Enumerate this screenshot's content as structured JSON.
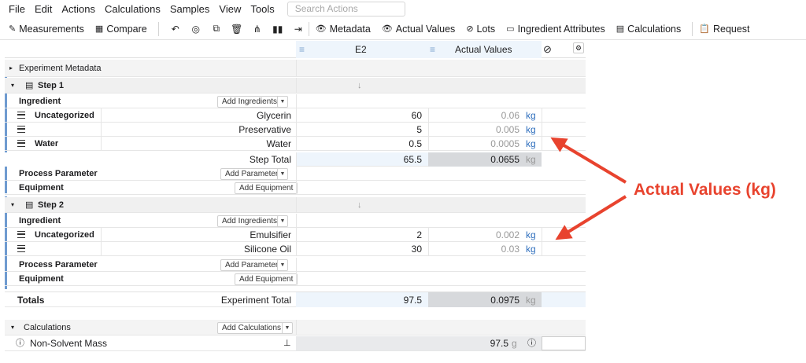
{
  "menu": [
    "File",
    "Edit",
    "Actions",
    "Calculations",
    "Samples",
    "View",
    "Tools"
  ],
  "search": {
    "placeholder": "Search Actions"
  },
  "toolbar": {
    "measurements": "Measurements",
    "compare": "Compare",
    "metadata": "Metadata",
    "actual_values": "Actual Values",
    "lots": "Lots",
    "ingredient_attributes": "Ingredient Attributes",
    "calculations": "Calculations",
    "request": "Request"
  },
  "columns": {
    "e2": "E2",
    "actual": "Actual Values"
  },
  "experiment_metadata": "Experiment Metadata",
  "step1": {
    "title": "Step 1",
    "ingredient": "Ingredient",
    "add_ingredients": "Add Ingredients",
    "rows": [
      {
        "group": "Uncategorized",
        "name": "Glycerin",
        "e2": "60",
        "actual": "0.06",
        "unit": "kg"
      },
      {
        "group": "",
        "name": "Preservative",
        "e2": "5",
        "actual": "0.005",
        "unit": "kg"
      },
      {
        "group": "Water",
        "name": "Water",
        "e2": "0.5",
        "actual": "0.0005",
        "unit": "kg"
      }
    ],
    "total_label": "Step Total",
    "total_e2": "65.5",
    "total_actual": "0.0655",
    "total_unit": "kg",
    "process_parameter": "Process Parameter",
    "add_parameter": "Add Parameter",
    "equipment": "Equipment",
    "add_equipment": "Add Equipment"
  },
  "step2": {
    "title": "Step 2",
    "ingredient": "Ingredient",
    "add_ingredients": "Add Ingredients",
    "rows": [
      {
        "group": "Uncategorized",
        "name": "Emulsifier",
        "e2": "2",
        "actual": "0.002",
        "unit": "kg"
      },
      {
        "group": "",
        "name": "Silicone Oil",
        "e2": "30",
        "actual": "0.03",
        "unit": "kg"
      }
    ],
    "process_parameter": "Process Parameter",
    "add_parameter": "Add Parameter",
    "equipment": "Equipment",
    "add_equipment": "Add Equipment"
  },
  "totals": {
    "label": "Totals",
    "exp_label": "Experiment Total",
    "e2": "97.5",
    "actual": "0.0975",
    "unit": "kg"
  },
  "calculations": {
    "label": "Calculations",
    "add": "Add Calculations",
    "row_name": "Non-Solvent Mass",
    "value": "97.5",
    "unit": "g"
  },
  "annotation": {
    "text": "Actual Values (kg)",
    "color": "#e8432e"
  }
}
